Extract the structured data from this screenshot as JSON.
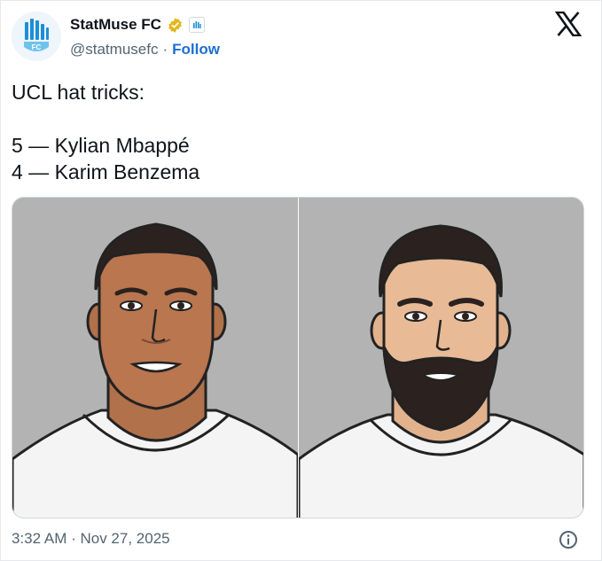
{
  "account": {
    "display_name": "StatMuse FC",
    "handle": "@statmusefc",
    "separator": "·",
    "follow_label": "Follow",
    "avatar_text": "FC",
    "verified_icon": "gold-verified-badge-icon",
    "affiliate_icon": "affiliate-badge-icon"
  },
  "tweet": {
    "lines": [
      "UCL hat tricks:",
      "",
      "5 — Kylian Mbappé",
      "4 — Karim Benzema"
    ]
  },
  "media": {
    "images": [
      {
        "name": "illustration-kylian-mbappe",
        "icon": "player-cartoon-portrait"
      },
      {
        "name": "illustration-karim-benzema",
        "icon": "player-cartoon-portrait-bearded"
      }
    ],
    "background_color": "#b3b3b3"
  },
  "footer": {
    "timestamp": "3:32 AM · Nov 27, 2025",
    "info_icon": "info-icon"
  },
  "colors": {
    "link": "#1d6fd1",
    "muted": "#536471",
    "text": "#0f1419",
    "gold_badge": "#e2b719"
  }
}
